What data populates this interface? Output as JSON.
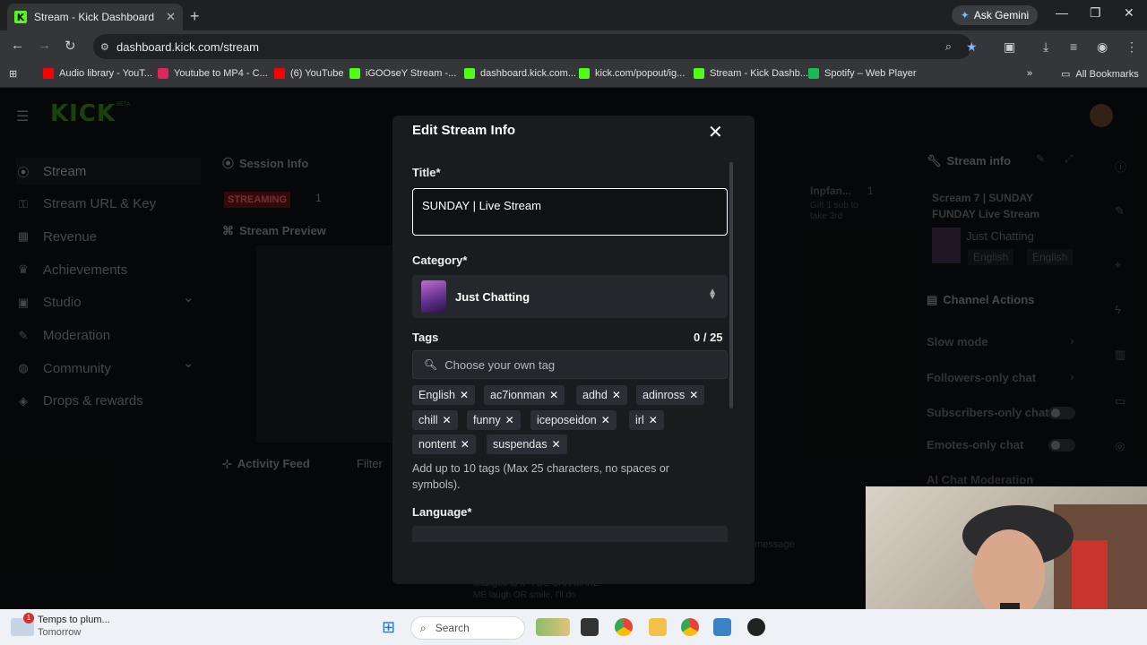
{
  "browser": {
    "tab_title": "Stream - Kick Dashboard",
    "tab_favicon": "K",
    "new_tab": "+",
    "ask_gemini": "Ask Gemini",
    "url": "dashboard.kick.com/stream",
    "bookmarks": [
      {
        "label": "Audio library - YouT...",
        "icon": "youtube-icon",
        "color": "#ff0000"
      },
      {
        "label": "Youtube to MP4 - C...",
        "icon": "download-icon",
        "color": "#e0245e"
      },
      {
        "label": "(6) YouTube",
        "icon": "youtube-icon",
        "color": "#ff0000"
      },
      {
        "label": "iGOOseY Stream -...",
        "icon": "kick-icon",
        "color": "#53fc18"
      },
      {
        "label": "dashboard.kick.com...",
        "icon": "kick-icon",
        "color": "#53fc18"
      },
      {
        "label": "kick.com/popout/ig...",
        "icon": "kick-icon",
        "color": "#53fc18"
      },
      {
        "label": "Stream - Kick Dashb...",
        "icon": "kick-icon",
        "color": "#53fc18"
      },
      {
        "label": "Spotify – Web Player",
        "icon": "spotify-icon",
        "color": "#1db954"
      }
    ],
    "all_bookmarks": "All Bookmarks"
  },
  "app": {
    "logo": "KICK",
    "logo_badge": "BETA",
    "sidebar": [
      {
        "label": "Stream",
        "icon": "broadcast-icon"
      },
      {
        "label": "Stream URL & Key",
        "icon": "key-icon"
      },
      {
        "label": "Revenue",
        "icon": "revenue-icon"
      },
      {
        "label": "Achievements",
        "icon": "trophy-icon"
      },
      {
        "label": "Studio",
        "icon": "studio-icon"
      },
      {
        "label": "Moderation",
        "icon": "wrench-icon"
      },
      {
        "label": "Community",
        "icon": "globe-icon"
      },
      {
        "label": "Drops & rewards",
        "icon": "gift-icon"
      }
    ],
    "session_info": "Session Info",
    "streaming_badge": "STREAMING",
    "streaming_count": "1",
    "stream_preview": "Stream Preview",
    "activity_feed": "Activity Feed",
    "filter": "Filter",
    "chat_user": "Inpfan...",
    "chat_gift_line1": "Gift 1 sub to",
    "chat_gift_line2": "take 3rd",
    "chat_count": "1",
    "chat_msg_line1": "changed to   IF YOU CAN MAKE",
    "chat_msg_line2": "ME laugh OR smile, I'll do",
    "send_message": "message",
    "stream_info": "Stream info",
    "stream_info_title": "Scream 7 | SUNDAY FUNDAY Live Stream",
    "stream_info_category": "Just Chatting",
    "stream_info_tags": [
      "English",
      "English"
    ],
    "channel_actions": "Channel Actions",
    "actions": [
      "Slow mode",
      "Followers-only chat",
      "Subscribers-only chat",
      "Emotes-only chat"
    ],
    "ai_moderation": "AI Chat Moderation"
  },
  "modal": {
    "title": "Edit Stream Info",
    "title_label": "Title*",
    "title_value": "SUNDAY | Live Stream",
    "category_label": "Category*",
    "category_value": "Just Chatting",
    "tags_label": "Tags",
    "tags_count": "0 / 25",
    "tag_placeholder": "Choose your own tag",
    "tags": [
      "English",
      "ac7ionman",
      "adhd",
      "adinross",
      "chill",
      "funny",
      "iceposeidon",
      "irl",
      "nontent",
      "suspendas"
    ],
    "tag_help": "Add up to 10 tags (Max 25 characters, no spaces or symbols).",
    "language_label": "Language*"
  },
  "taskbar": {
    "notification_badge": "1",
    "weather_line1": "Temps to plum...",
    "weather_line2": "Tomorrow",
    "search": "Search"
  }
}
